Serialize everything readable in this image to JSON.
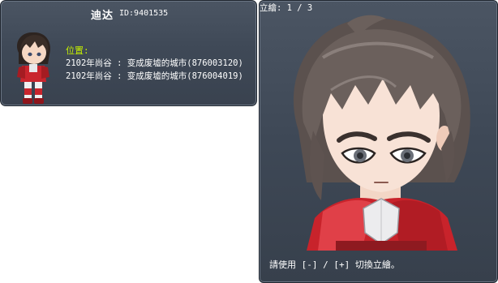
{
  "info": {
    "name": "迪达",
    "id_text": "ID:9401535",
    "location_label": "位置:",
    "locations": [
      "2102年尚谷 : 变成废墟的城市(876003120)",
      "2102年尚谷 : 变成废墟的城市(876004019)"
    ]
  },
  "portrait": {
    "counter": "立繪: 1 / 3",
    "hint": "請使用 [-] / [+] 切換立繪。"
  },
  "colors": {
    "panel_bg": "#434c59",
    "location_label": "#c6f000",
    "text": "#ffffff"
  }
}
